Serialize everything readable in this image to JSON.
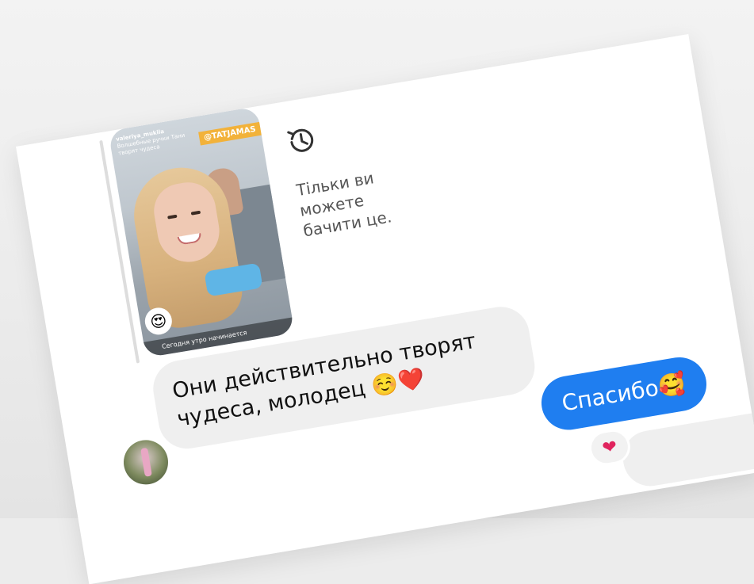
{
  "story": {
    "username": "valeriya_mukila",
    "caption": "Волшебные ручки Тани творят чудеса",
    "tag": "@TATJAMAS",
    "footer_text": "Сегодня утро начинается",
    "reaction": "😍"
  },
  "notice": {
    "icon": "history-icon",
    "text": "Тільки ви можете бачити це."
  },
  "messages": {
    "incoming": "Они действительно творят чудеса, молодец ☺️❤️",
    "outgoing": "Спасибо🥰",
    "reaction": "❤"
  },
  "colors": {
    "outgoing_bubble": "#1f7ef0",
    "incoming_bubble": "#efefef",
    "notice_text": "#555555",
    "story_tag": "#f2b23a"
  }
}
